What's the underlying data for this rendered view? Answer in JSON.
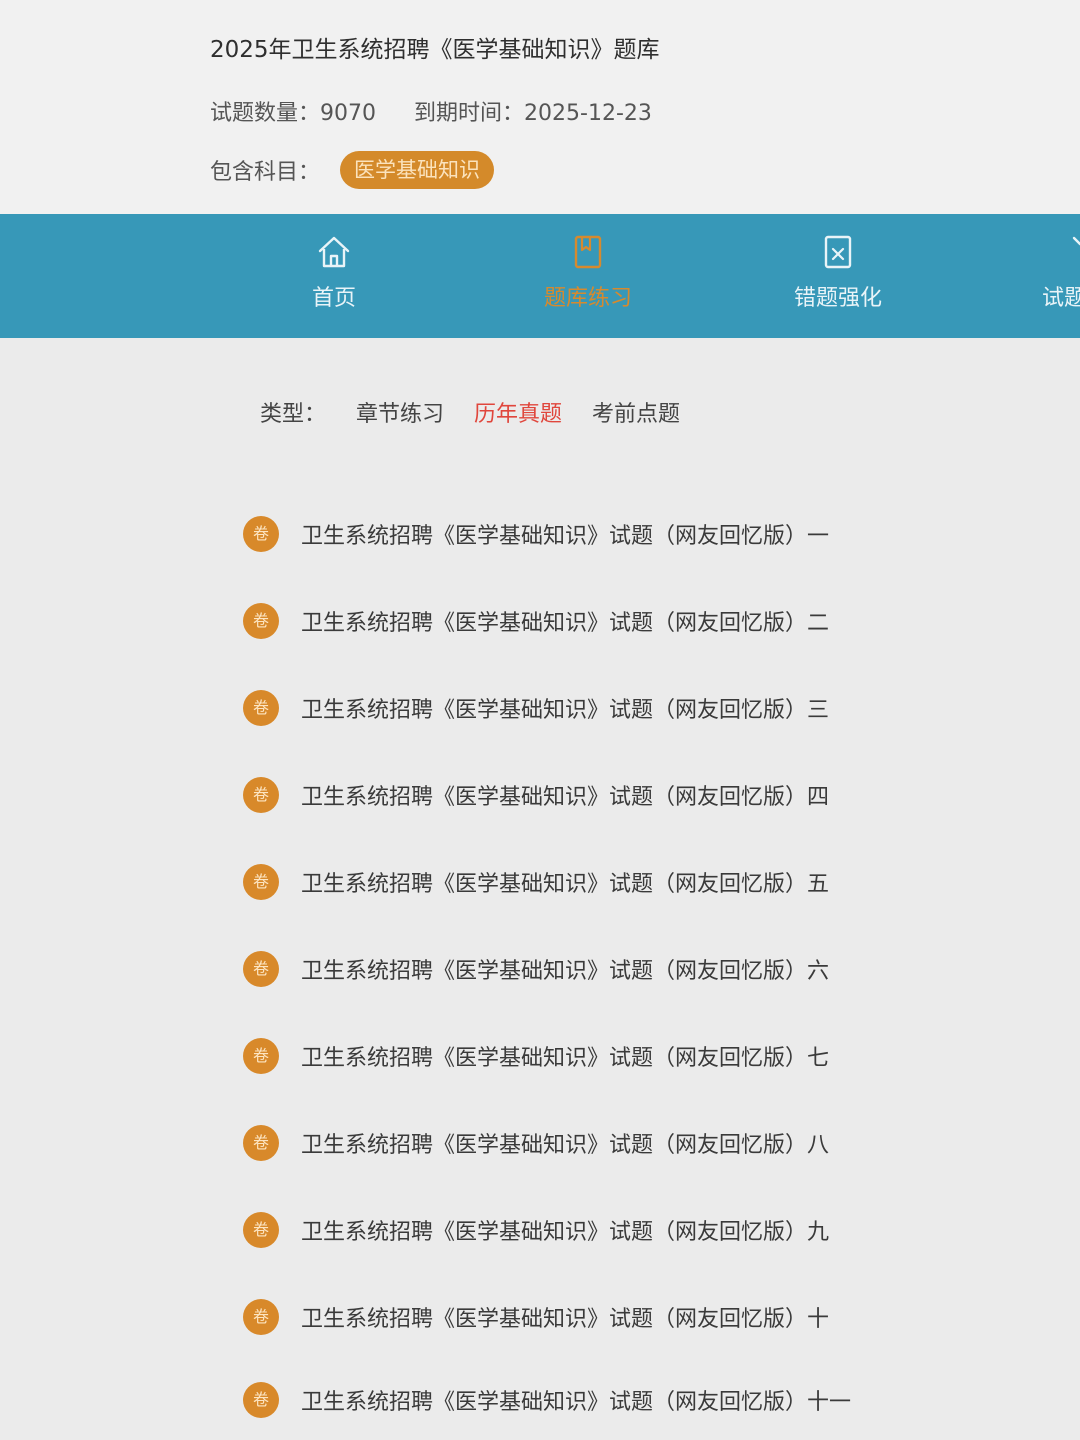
{
  "header": {
    "bank_title": "2025年卫生系统招聘《医学基础知识》题库",
    "question_count_label": "试题数量：",
    "question_count": "9070",
    "expiry_label": "到期时间：",
    "expiry_date": "2025-12-23",
    "subjects_label": "包含科目：",
    "subject_tag": "医学基础知识"
  },
  "nav": {
    "items": [
      {
        "label": "首页",
        "icon": "home-icon"
      },
      {
        "label": "题库练习",
        "icon": "practice-icon",
        "active": true
      },
      {
        "label": "错题强化",
        "icon": "wrong-questions-icon"
      },
      {
        "label": "试题",
        "icon": "exam-icon"
      }
    ]
  },
  "filter": {
    "type_label": "类型：",
    "options": [
      "章节练习",
      "历年真题",
      "考前点题"
    ],
    "active_option": "历年真题"
  },
  "papers": {
    "badge": "卷",
    "items": [
      "卫生系统招聘《医学基础知识》试题（网友回忆版）一",
      "卫生系统招聘《医学基础知识》试题（网友回忆版）二",
      "卫生系统招聘《医学基础知识》试题（网友回忆版）三",
      "卫生系统招聘《医学基础知识》试题（网友回忆版）四",
      "卫生系统招聘《医学基础知识》试题（网友回忆版）五",
      "卫生系统招聘《医学基础知识》试题（网友回忆版）六",
      "卫生系统招聘《医学基础知识》试题（网友回忆版）七",
      "卫生系统招聘《医学基础知识》试题（网友回忆版）八",
      "卫生系统招聘《医学基础知识》试题（网友回忆版）九",
      "卫生系统招聘《医学基础知识》试题（网友回忆版）十",
      "卫生系统招聘《医学基础知识》试题（网友回忆版）十一"
    ]
  },
  "colors": {
    "nav_bar": "#3798b8",
    "accent_orange": "#d8892a",
    "active_red": "#e0463c"
  }
}
